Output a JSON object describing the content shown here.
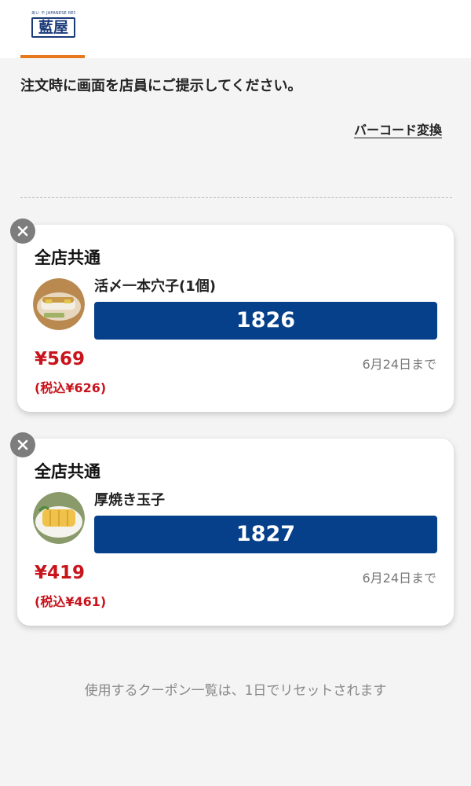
{
  "header": {
    "logo_tagline": "あい や  JAPANESE RESTAURANT",
    "logo_text": "藍屋"
  },
  "instruction": "注文時に画面を店員にご提示してください。",
  "barcode_link": "バーコード変換",
  "coupons": [
    {
      "scope": "全店共通",
      "item_name": "活〆一本穴子(1個)",
      "code": "1826",
      "price": "¥569",
      "price_with_tax": "(税込¥626)",
      "expiry": "6月24日まで",
      "thumbnail_icon": "anago-sushi-image"
    },
    {
      "scope": "全店共通",
      "item_name": "厚焼き玉子",
      "code": "1827",
      "price": "¥419",
      "price_with_tax": "(税込¥461)",
      "expiry": "6月24日まで",
      "thumbnail_icon": "tamagoyaki-image"
    }
  ],
  "footer_note": "使用するクーポン一覧は、1日でリセットされます",
  "colors": {
    "accent_orange": "#e8781e",
    "code_bar_blue": "#06408a",
    "price_red": "#c8141c",
    "brand_navy": "#1b3a78"
  }
}
